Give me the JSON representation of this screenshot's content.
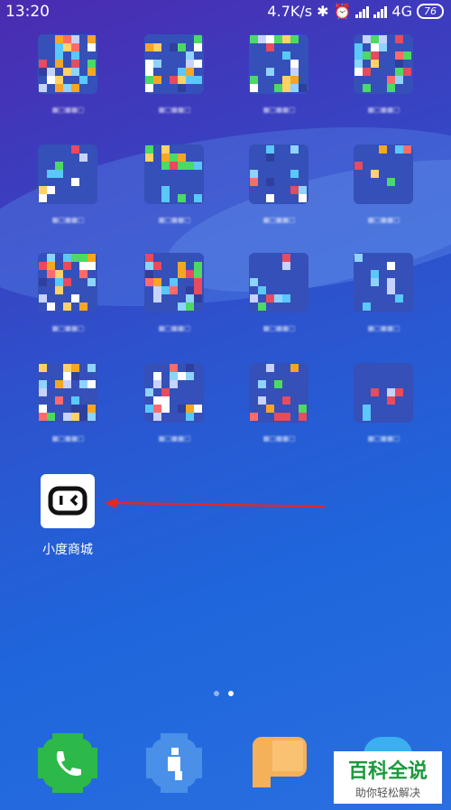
{
  "status_bar": {
    "time": "13:20",
    "network_speed": "4.7K/s",
    "network_type": "4G",
    "battery": "76"
  },
  "home_screen": {
    "app_label": "小度商城"
  },
  "page_indicator": {
    "count": 2,
    "active": 2
  },
  "watermark": {
    "title": "百科全说",
    "subtitle": "助你轻松解决"
  },
  "colors": {
    "wallpaper_top": "#4b2bb0",
    "wallpaper_bottom": "#2a6fe0",
    "arrow": "#e0282a",
    "phone_green": "#2db84a",
    "watermark_green": "#1a9a3c"
  }
}
